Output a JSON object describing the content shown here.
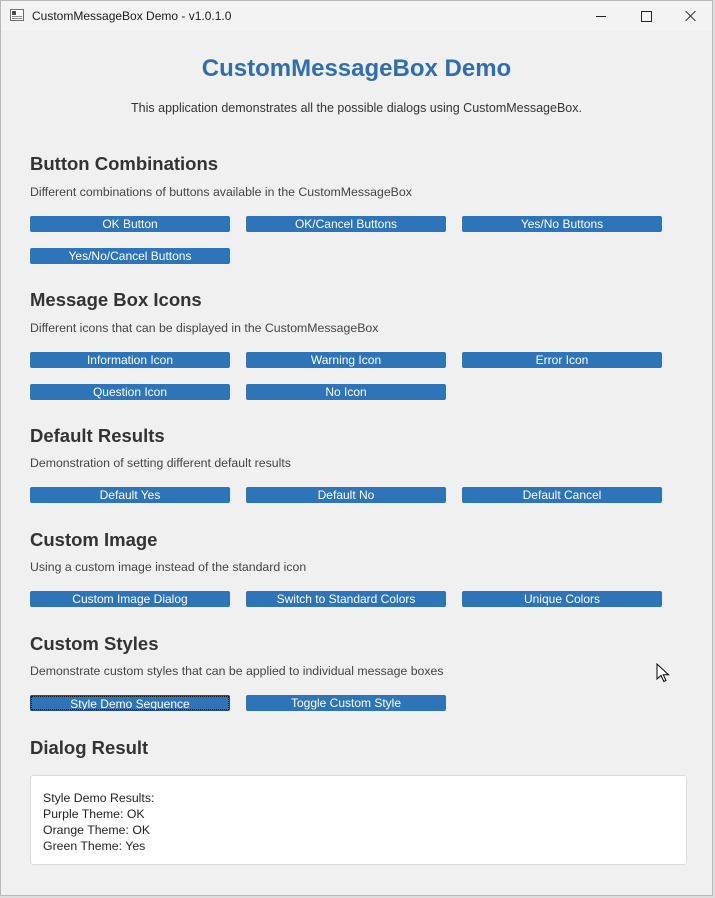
{
  "window": {
    "title": "CustomMessageBox Demo - v1.0.1.0"
  },
  "header": {
    "title": "CustomMessageBox Demo",
    "subtitle": "This application demonstrates all the possible dialogs using CustomMessageBox."
  },
  "sections": {
    "button_combinations": {
      "title": "Button Combinations",
      "description": "Different combinations of buttons available in the CustomMessageBox",
      "buttons": [
        "OK Button",
        "OK/Cancel Buttons",
        "Yes/No Buttons",
        "Yes/No/Cancel Buttons"
      ]
    },
    "icons": {
      "title": "Message Box Icons",
      "description": "Different icons that can be displayed in the CustomMessageBox",
      "buttons": [
        "Information Icon",
        "Warning Icon",
        "Error Icon",
        "Question Icon",
        "No Icon"
      ]
    },
    "default_results": {
      "title": "Default Results",
      "description": "Demonstration of setting different default results",
      "buttons": [
        "Default Yes",
        "Default No",
        "Default Cancel"
      ]
    },
    "custom_image": {
      "title": "Custom Image",
      "description": "Using a custom image instead of the standard icon",
      "buttons": [
        "Custom Image Dialog",
        "Switch to Standard Colors",
        "Unique Colors"
      ]
    },
    "custom_styles": {
      "title": "Custom Styles",
      "description": "Demonstrate custom styles that can be applied to individual message boxes",
      "buttons": [
        "Style Demo Sequence",
        "Toggle Custom Style"
      ]
    },
    "dialog_result": {
      "title": "Dialog Result",
      "lines": [
        "Style Demo Results:",
        "Purple Theme: OK",
        "Orange Theme: OK",
        "Green Theme: Yes"
      ]
    }
  },
  "colors": {
    "accent": "#2e74b8",
    "title": "#2f6fb1",
    "background": "#f0f0f0"
  }
}
